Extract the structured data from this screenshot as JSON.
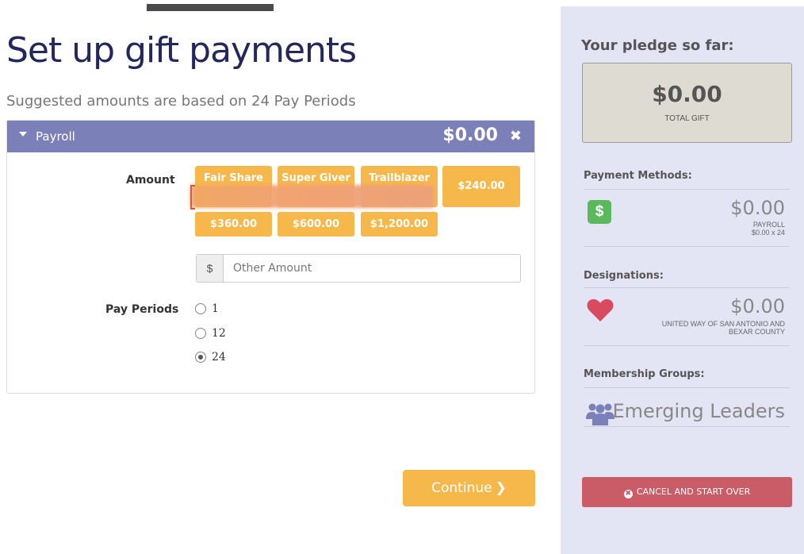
{
  "page": {
    "title": "Set up gift payments",
    "subtitle": "Suggested amounts are based on 24 Pay Periods"
  },
  "payroll_panel": {
    "label": "Payroll",
    "total": "$0.00",
    "close_glyph": "✖",
    "amount_label": "Amount",
    "tier_buttons": [
      "Fair Share",
      "Super Giver",
      "Trailblazer"
    ],
    "amount_options": [
      "$240.00",
      "$360.00",
      "$600.00",
      "$1,200.00"
    ],
    "other_amount": {
      "addon": "$",
      "placeholder": "Other Amount",
      "value": ""
    },
    "pay_periods_label": "Pay Periods",
    "pay_periods": [
      {
        "label": "1",
        "checked": false
      },
      {
        "label": "12",
        "checked": false
      },
      {
        "label": "24",
        "checked": true
      }
    ]
  },
  "continue_button": {
    "label": "Continue",
    "chevron": "❯"
  },
  "sidebar": {
    "heading": "Your pledge so far:",
    "total_value": "$0.00",
    "total_caption": "TOTAL GIFT",
    "payment_methods": {
      "title": "Payment Methods:",
      "icon": "dollar-icon",
      "icon_glyph": "$",
      "amount": "$0.00",
      "detail_line1": "PAYROLL",
      "detail_line2": "$0.00 x 24"
    },
    "designations": {
      "title": "Designations:",
      "icon": "heart-icon",
      "amount": "$0.00",
      "detail_line1": "UNITED WAY OF SAN ANTONIO AND",
      "detail_line2": "BEXAR COUNTY"
    },
    "membership_groups": {
      "title": "Membership Groups:",
      "icon": "people-icon",
      "name": "Emerging Leaders"
    },
    "cancel_button": {
      "label": "CANCEL AND START OVER",
      "icon_glyph": "✖"
    }
  },
  "colors": {
    "title": "#23275e",
    "panel_header": "#7b80b8",
    "amount_button": "#f7b84b",
    "sidebar_bg": "#e3e5f5",
    "cancel_button": "#ca5c67",
    "dollar_icon": "#5cb85c",
    "heart_icon": "#d9495f",
    "people_icon": "#7b80b8"
  }
}
